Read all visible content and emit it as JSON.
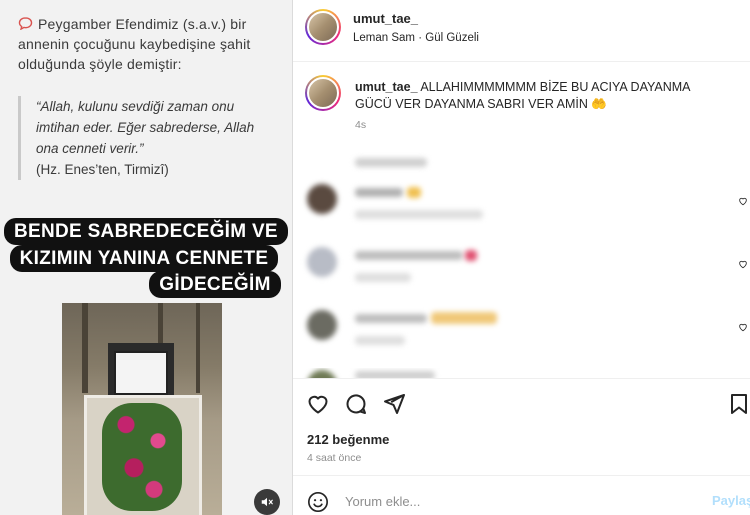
{
  "media": {
    "intro": "Peygamber Efendimiz (s.a.v.) bir annenin çocuğunu kaybedişine şahit olduğunda şöyle demiştir:",
    "quote": "“Allah, kulunu sevdiği zaman onu imtihan eder. Eğer sabrederse, Allah ona cenneti verir.”",
    "source": "(Hz. Enes’ten, Tirmizî)",
    "banner": [
      "BENDE SABREDECEĞİM VE",
      "KIZIMIN YANINA CENNETE",
      "GİDECEĞİM"
    ]
  },
  "post": {
    "username": "umut_tae_",
    "audio": "Leman Sam",
    "audio_sep": "·",
    "song": "Gül Güzeli",
    "caption_user": "umut_tae_",
    "caption_text": "ALLAHIMMMMMMM BİZE BU ACIYA DAYANMA GÜCÜ VER DAYANMA SABRI VER AMİN 🤲",
    "caption_time": "4s",
    "likes": "212 beğenme",
    "time_ago": "4 saat önce"
  },
  "composer": {
    "placeholder": "Yorum ekle...",
    "post_label": "Paylaş"
  }
}
